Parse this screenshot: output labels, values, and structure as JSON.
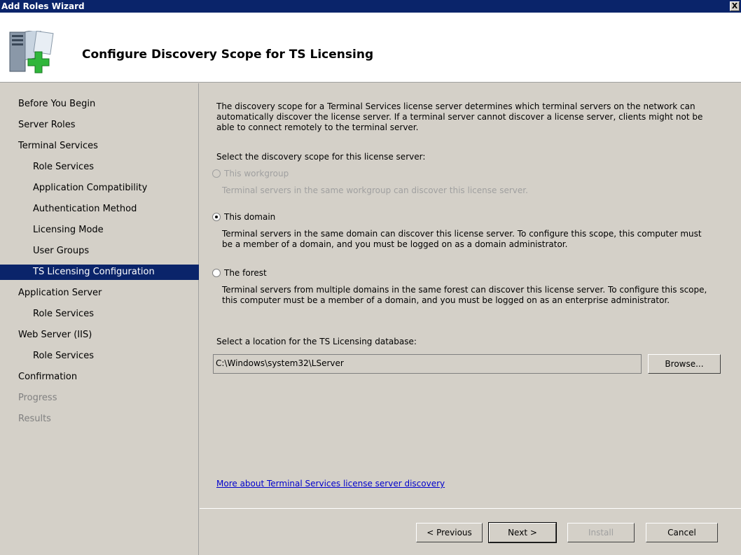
{
  "window": {
    "title": "Add Roles Wizard",
    "close_label": "X"
  },
  "header": {
    "title": "Configure Discovery Scope for TS Licensing",
    "icon": "server-add-icon"
  },
  "sidebar": {
    "items": [
      {
        "label": "Before You Begin",
        "level": 0,
        "state": "normal"
      },
      {
        "label": "Server Roles",
        "level": 0,
        "state": "normal"
      },
      {
        "label": "Terminal Services",
        "level": 0,
        "state": "normal"
      },
      {
        "label": "Role Services",
        "level": 1,
        "state": "normal"
      },
      {
        "label": "Application Compatibility",
        "level": 1,
        "state": "normal"
      },
      {
        "label": "Authentication Method",
        "level": 1,
        "state": "normal"
      },
      {
        "label": "Licensing Mode",
        "level": 1,
        "state": "normal"
      },
      {
        "label": "User Groups",
        "level": 1,
        "state": "normal"
      },
      {
        "label": "TS Licensing Configuration",
        "level": 1,
        "state": "selected"
      },
      {
        "label": "Application Server",
        "level": 0,
        "state": "normal"
      },
      {
        "label": "Role Services",
        "level": 1,
        "state": "normal"
      },
      {
        "label": "Web Server (IIS)",
        "level": 0,
        "state": "normal"
      },
      {
        "label": "Role Services",
        "level": 1,
        "state": "normal"
      },
      {
        "label": "Confirmation",
        "level": 0,
        "state": "normal"
      },
      {
        "label": "Progress",
        "level": 0,
        "state": "disabled"
      },
      {
        "label": "Results",
        "level": 0,
        "state": "disabled"
      }
    ]
  },
  "main": {
    "description": "The discovery scope for a Terminal Services license server determines which terminal servers on the network can automatically discover the license server. If a terminal server cannot discover a license server, clients might not be able to connect remotely to the terminal server.",
    "scope_prompt": "Select the discovery scope for this license server:",
    "options": [
      {
        "label": "This workgroup",
        "description": "Terminal servers in the same workgroup can discover this license server.",
        "selected": false,
        "disabled": true
      },
      {
        "label": "This domain",
        "description": "Terminal servers in the same domain can discover this license server. To configure this scope, this computer must be a member of a domain, and you must be logged on as a domain administrator.",
        "selected": true,
        "disabled": false
      },
      {
        "label": "The forest",
        "description": "Terminal servers from multiple domains in the same forest can discover this license server. To configure this scope, this computer must be a member of a domain, and you must be logged on as an enterprise administrator.",
        "selected": false,
        "disabled": false
      }
    ],
    "location_prompt": "Select a location for the TS Licensing database:",
    "location_value": "C:\\Windows\\system32\\LServer",
    "browse_label": "Browse...",
    "help_link": "More about Terminal Services license server discovery"
  },
  "footer": {
    "previous_label": "< Previous",
    "next_label": "Next >",
    "install_label": "Install",
    "cancel_label": "Cancel"
  }
}
